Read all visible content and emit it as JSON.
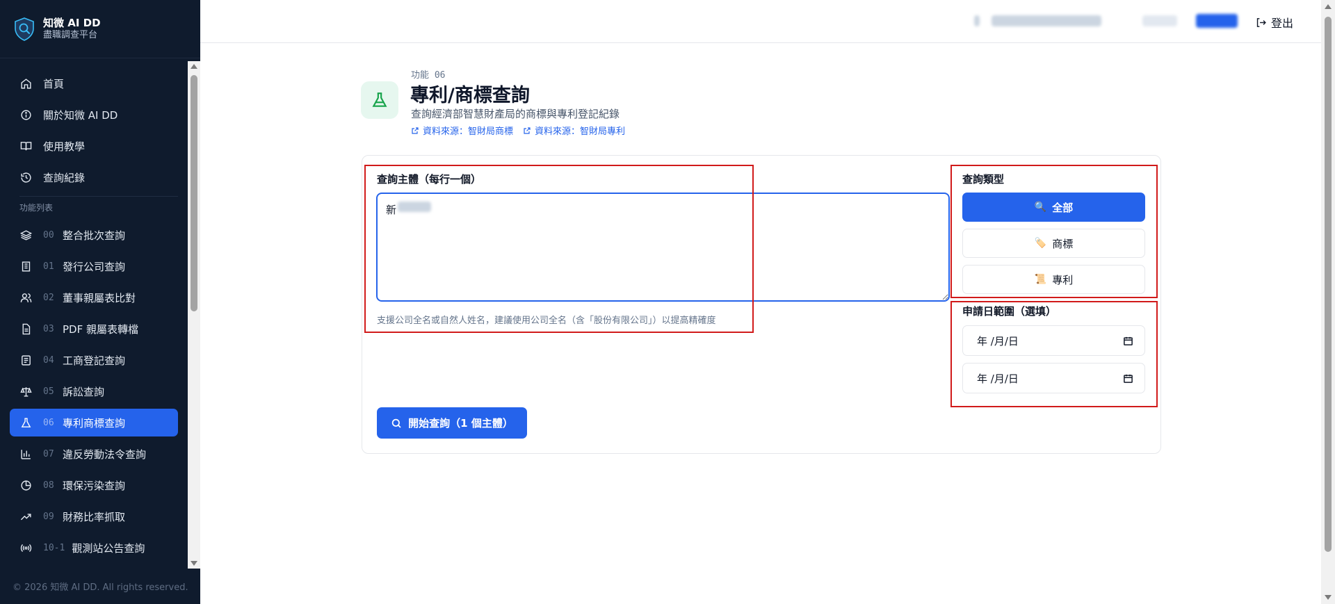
{
  "brand": {
    "title": "知微 AI DD",
    "subtitle": "盡職調查平台"
  },
  "sidebar": {
    "top_items": [
      {
        "label": "首頁",
        "icon": "home-icon"
      },
      {
        "label": "關於知微 AI DD",
        "icon": "info-icon"
      },
      {
        "label": "使用教學",
        "icon": "book-icon"
      },
      {
        "label": "查詢紀錄",
        "icon": "history-icon"
      }
    ],
    "section_label": "功能列表",
    "features": [
      {
        "num": "00",
        "label": "整合批次查詢",
        "icon": "layers-icon"
      },
      {
        "num": "01",
        "label": "發行公司查詢",
        "icon": "building-icon"
      },
      {
        "num": "02",
        "label": "董事親屬表比對",
        "icon": "users-icon"
      },
      {
        "num": "03",
        "label": "PDF 親屬表轉檔",
        "icon": "file-icon"
      },
      {
        "num": "04",
        "label": "工商登記查詢",
        "icon": "register-icon"
      },
      {
        "num": "05",
        "label": "訴訟查詢",
        "icon": "scale-icon"
      },
      {
        "num": "06",
        "label": "專利商標查詢",
        "icon": "flask-icon",
        "active": true
      },
      {
        "num": "07",
        "label": "違反勞動法令查詢",
        "icon": "bar-chart-icon"
      },
      {
        "num": "08",
        "label": "環保污染查詢",
        "icon": "pie-chart-icon"
      },
      {
        "num": "09",
        "label": "財務比率抓取",
        "icon": "trend-icon"
      },
      {
        "num": "10-1",
        "label": "觀測站公告查詢",
        "icon": "broadcast-icon"
      }
    ],
    "footer": "© 2026 知微 AI DD. All rights reserved."
  },
  "topbar": {
    "logout_label": "登出"
  },
  "feature": {
    "label": "功能 06",
    "title": "專利/商標查詢",
    "description": "查詢經濟部智慧財產局的商標與專利登記紀錄",
    "links": [
      "資料來源：智財局商標",
      "資料來源：智財局專利"
    ]
  },
  "form": {
    "subjects_label": "查詢主體（每行一個）",
    "subjects_value": "新",
    "hint": "支援公司全名或自然人姓名，建議使用公司全名（含「股份有限公司」）以提高精確度",
    "type_label": "查詢類型",
    "types": [
      {
        "emoji": "🔍",
        "label": "全部",
        "active": true
      },
      {
        "emoji": "🏷️",
        "label": "商標"
      },
      {
        "emoji": "📜",
        "label": "專利"
      }
    ],
    "date_label": "申請日範圍（選填）",
    "date_start": "年 /月/日",
    "date_end": "年 /月/日",
    "submit_label": "開始查詢（1 個主體）"
  },
  "colors": {
    "accent": "#2563eb",
    "sidebar_bg": "#0f1b2d",
    "annotation": "#d11a1a"
  }
}
